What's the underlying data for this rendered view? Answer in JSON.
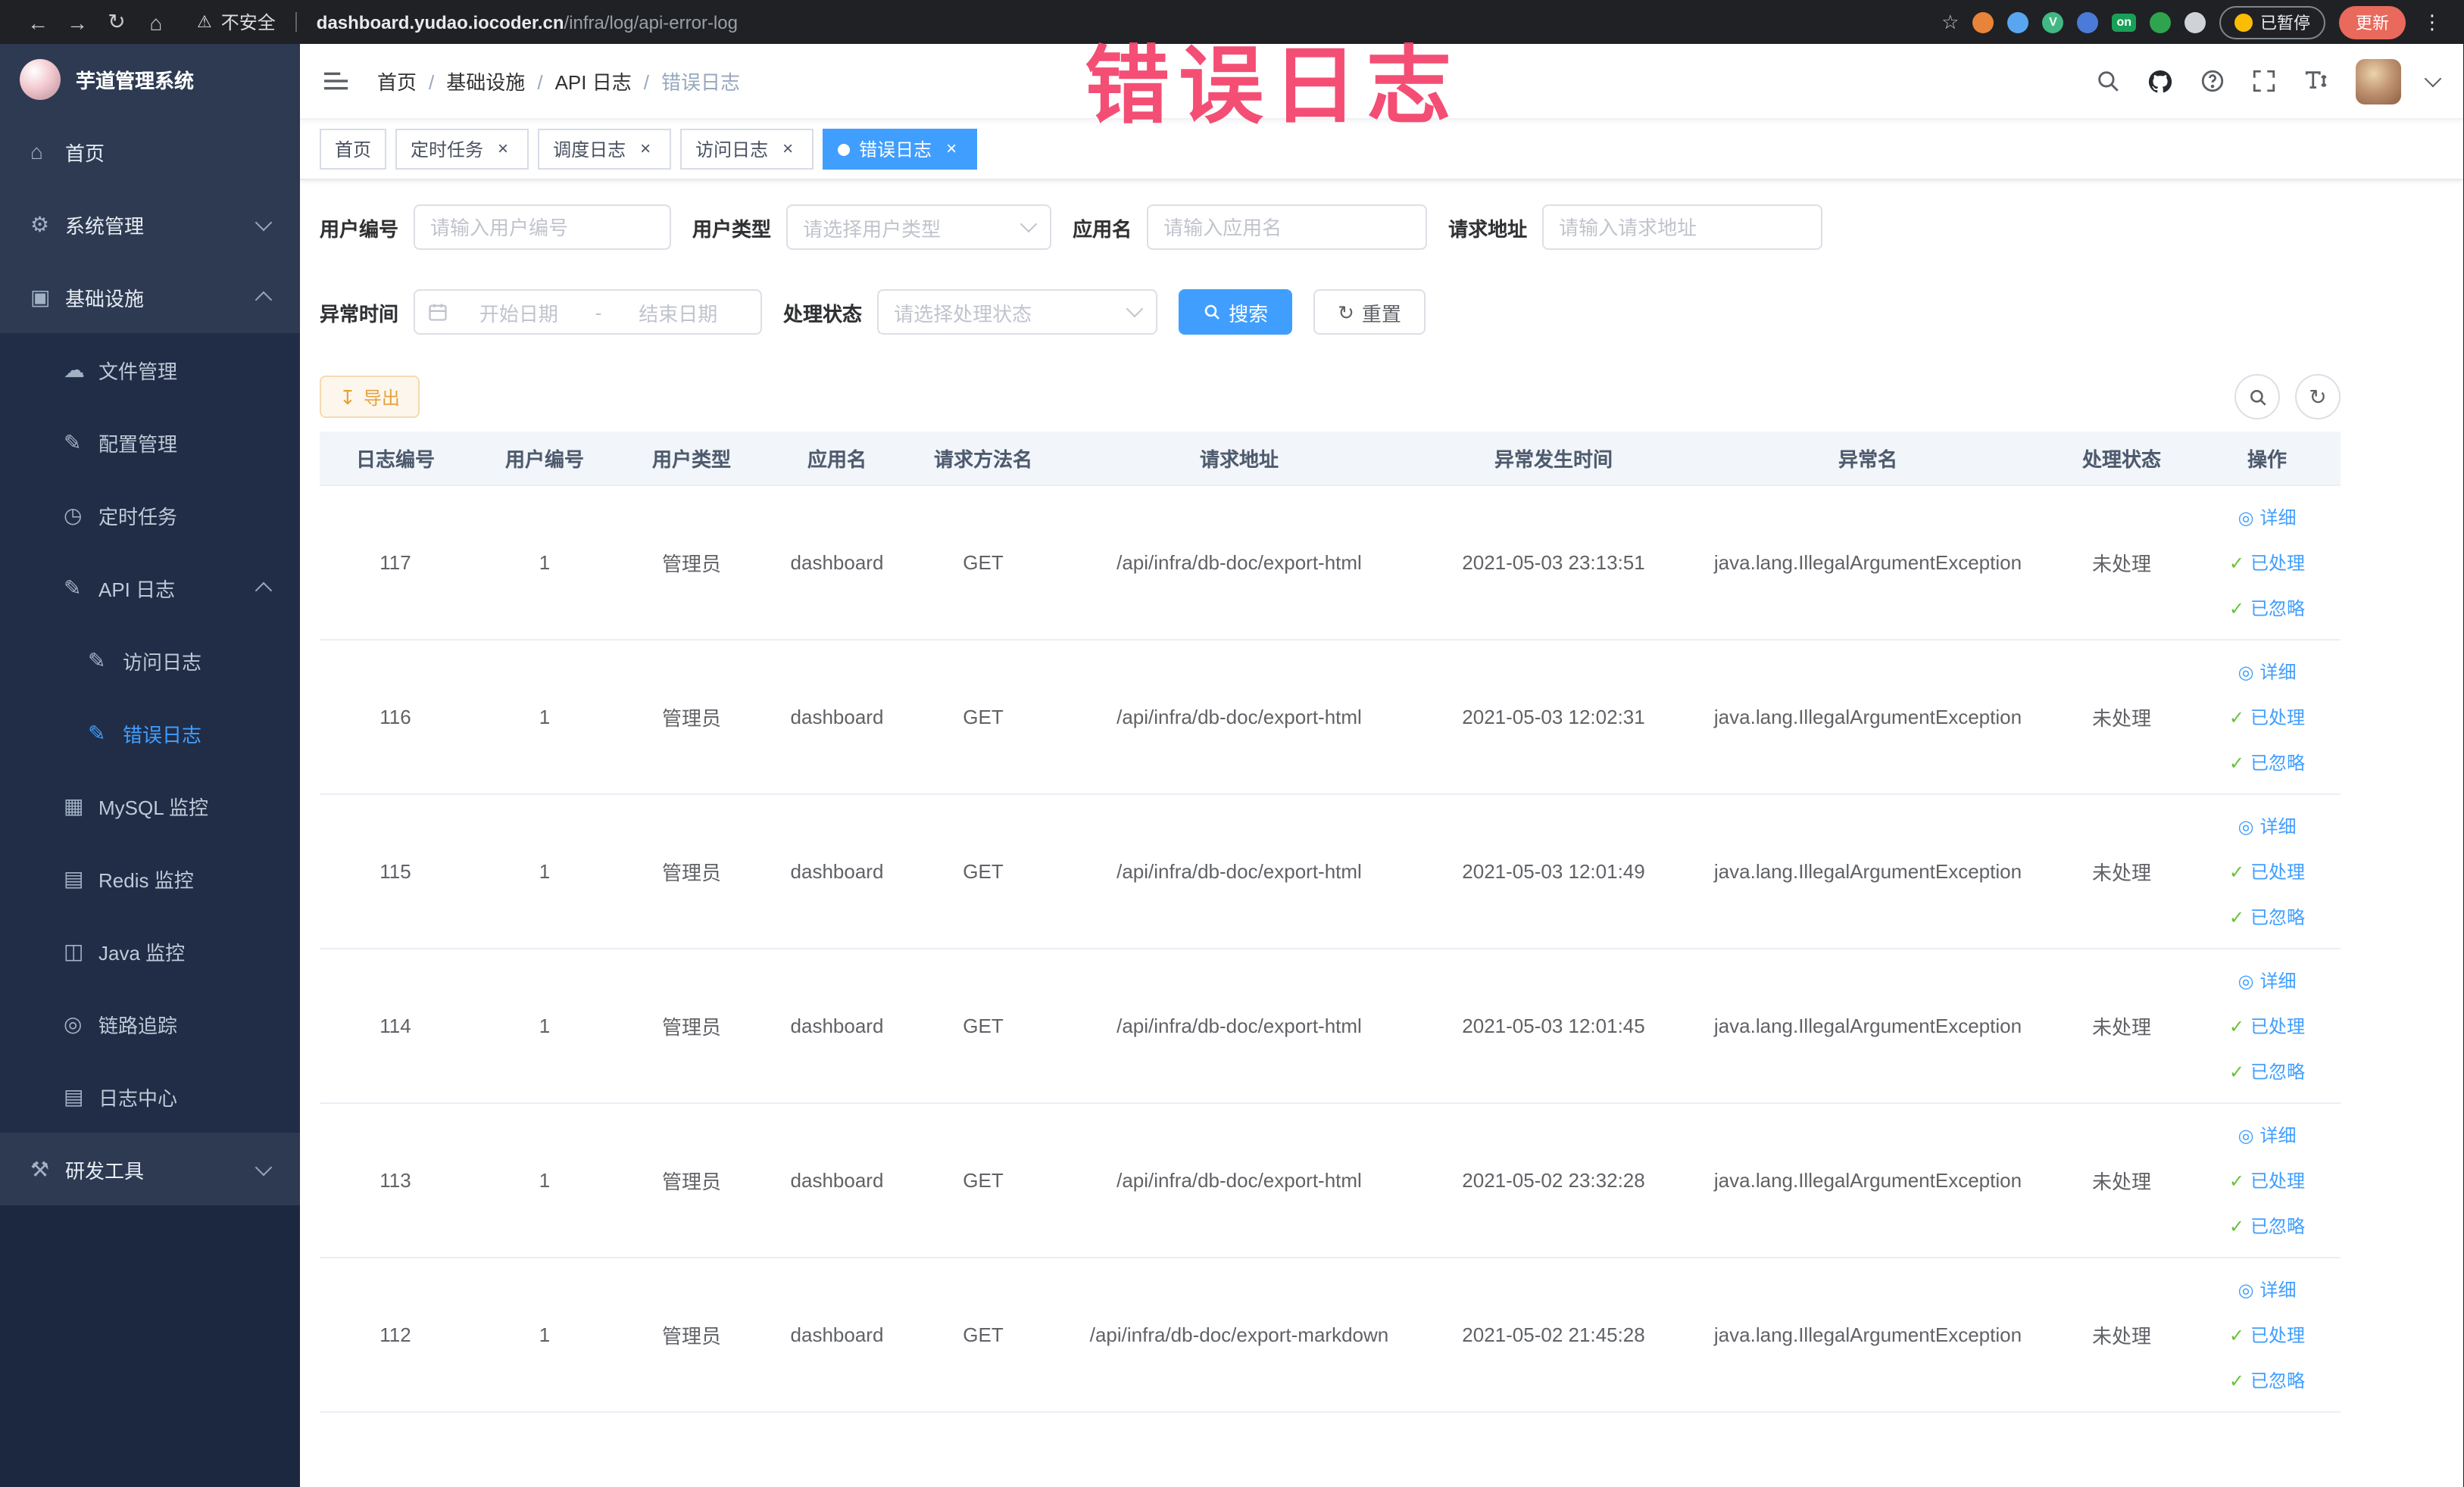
{
  "theme": {
    "primary": "#409eff",
    "success": "#67c23a",
    "warning": "#e6a23c"
  },
  "annotation": {
    "text": "错误日志",
    "color": "#f4436c"
  },
  "browser": {
    "security_label": "不安全",
    "url_host": "dashboard.yudao.iocoder.cn",
    "url_path": "/infra/log/api-error-log",
    "paused_label": "已暂停",
    "update_label": "更新",
    "extensions": [
      {
        "name": "orange-extension-icon",
        "color": "#e8833a"
      },
      {
        "name": "blue-drop-extension-icon",
        "color": "#58a6f0"
      },
      {
        "name": "vue-devtools-extension-icon",
        "color": "#41b883",
        "letter": "V"
      },
      {
        "name": "blue-grid-extension-icon",
        "color": "#4a7bd8"
      },
      {
        "name": "switch-on-extension-badge",
        "color": "#18a058",
        "letter": "on",
        "badge": true
      },
      {
        "name": "leaf-extension-icon",
        "color": "#2ea44f"
      },
      {
        "name": "paw-extension-icon",
        "color": "#cfd2d6"
      }
    ]
  },
  "sidebar": {
    "title": "芋道管理系统",
    "menu": [
      {
        "name": "home",
        "label": "首页",
        "icon": "home-icon",
        "level": 0,
        "section": "top"
      },
      {
        "name": "system-management",
        "label": "系统管理",
        "icon": "gear-icon",
        "level": 0,
        "chevron": "down",
        "section": "top"
      },
      {
        "name": "infrastructure",
        "label": "基础设施",
        "icon": "monitor-icon",
        "level": 0,
        "chevron": "up",
        "section": "top"
      },
      {
        "name": "file-management",
        "label": "文件管理",
        "icon": "cloud-icon",
        "level": 1,
        "section": "sub"
      },
      {
        "name": "config-management",
        "label": "配置管理",
        "icon": "pencil-icon",
        "level": 1,
        "section": "sub"
      },
      {
        "name": "scheduled-tasks",
        "label": "定时任务",
        "icon": "clock-icon",
        "level": 1,
        "section": "sub"
      },
      {
        "name": "api-log",
        "label": "API 日志",
        "icon": "pencil-icon",
        "level": 1,
        "chevron": "up",
        "section": "sub"
      },
      {
        "name": "access-log",
        "label": "访问日志",
        "icon": "pencil-icon",
        "level": 2,
        "section": "sub"
      },
      {
        "name": "error-log",
        "label": "错误日志",
        "icon": "pencil-icon",
        "level": 2,
        "active": true,
        "section": "sub"
      },
      {
        "name": "mysql-monitor",
        "label": "MySQL 监控",
        "icon": "grid-icon",
        "level": 1,
        "section": "sub"
      },
      {
        "name": "redis-monitor",
        "label": "Redis 监控",
        "icon": "stack-icon",
        "level": 1,
        "section": "sub"
      },
      {
        "name": "java-monitor",
        "label": "Java 监控",
        "icon": "window-icon",
        "level": 1,
        "section": "sub"
      },
      {
        "name": "link-tracing",
        "label": "链路追踪",
        "icon": "eye-icon",
        "level": 1,
        "section": "sub"
      },
      {
        "name": "log-center",
        "label": "日志中心",
        "icon": "stack-icon",
        "level": 1,
        "section": "sub"
      },
      {
        "name": "dev-tools",
        "label": "研发工具",
        "icon": "tools-icon",
        "level": 0,
        "chevron": "down",
        "section": "bottom"
      }
    ]
  },
  "navbar": {
    "breadcrumb": [
      "首页",
      "基础设施",
      "API 日志",
      "错误日志"
    ]
  },
  "tabs": [
    {
      "name": "home",
      "label": "首页"
    },
    {
      "name": "scheduled-tasks",
      "label": "定时任务",
      "closable": true
    },
    {
      "name": "schedule-log",
      "label": "调度日志",
      "closable": true
    },
    {
      "name": "access-log",
      "label": "访问日志",
      "closable": true
    },
    {
      "name": "error-log",
      "label": "错误日志",
      "closable": true,
      "active": true
    }
  ],
  "filters": {
    "user_id": {
      "label": "用户编号",
      "placeholder": "请输入用户编号"
    },
    "user_type": {
      "label": "用户类型",
      "placeholder": "请选择用户类型"
    },
    "app_name": {
      "label": "应用名",
      "placeholder": "请输入应用名"
    },
    "request_url": {
      "label": "请求地址",
      "placeholder": "请输入请求地址"
    },
    "exception_time": {
      "label": "异常时间",
      "start_placeholder": "开始日期",
      "separator": "-",
      "end_placeholder": "结束日期"
    },
    "process_status": {
      "label": "处理状态",
      "placeholder": "请选择处理状态"
    },
    "search_label": "搜索",
    "reset_label": "重置"
  },
  "toolbar": {
    "export_label": "导出"
  },
  "table": {
    "columns": [
      "日志编号",
      "用户编号",
      "用户类型",
      "应用名",
      "请求方法名",
      "请求地址",
      "异常发生时间",
      "异常名",
      "处理状态",
      "操作"
    ],
    "row_actions": [
      {
        "name": "detail-action",
        "label": "详细",
        "icon": "eye-icon"
      },
      {
        "name": "processed-action",
        "label": "已处理",
        "icon": "check-icon"
      },
      {
        "name": "ignored-action",
        "label": "已忽略",
        "icon": "check-icon"
      }
    ],
    "rows": [
      {
        "id": "117",
        "user_id": "1",
        "user_type": "管理员",
        "app_name": "dashboard",
        "method": "GET",
        "url": "/api/infra/db-doc/export-html",
        "time": "2021-05-03 23:13:51",
        "exception": "java.lang.IllegalArgumentException",
        "status": "未处理"
      },
      {
        "id": "116",
        "user_id": "1",
        "user_type": "管理员",
        "app_name": "dashboard",
        "method": "GET",
        "url": "/api/infra/db-doc/export-html",
        "time": "2021-05-03 12:02:31",
        "exception": "java.lang.IllegalArgumentException",
        "status": "未处理"
      },
      {
        "id": "115",
        "user_id": "1",
        "user_type": "管理员",
        "app_name": "dashboard",
        "method": "GET",
        "url": "/api/infra/db-doc/export-html",
        "time": "2021-05-03 12:01:49",
        "exception": "java.lang.IllegalArgumentException",
        "status": "未处理"
      },
      {
        "id": "114",
        "user_id": "1",
        "user_type": "管理员",
        "app_name": "dashboard",
        "method": "GET",
        "url": "/api/infra/db-doc/export-html",
        "time": "2021-05-03 12:01:45",
        "exception": "java.lang.IllegalArgumentException",
        "status": "未处理"
      },
      {
        "id": "113",
        "user_id": "1",
        "user_type": "管理员",
        "app_name": "dashboard",
        "method": "GET",
        "url": "/api/infra/db-doc/export-html",
        "time": "2021-05-02 23:32:28",
        "exception": "java.lang.IllegalArgumentException",
        "status": "未处理"
      },
      {
        "id": "112",
        "user_id": "1",
        "user_type": "管理员",
        "app_name": "dashboard",
        "method": "GET",
        "url": "/api/infra/db-doc/export-markdown",
        "time": "2021-05-02 21:45:28",
        "exception": "java.lang.IllegalArgumentException",
        "status": "未处理"
      }
    ]
  }
}
